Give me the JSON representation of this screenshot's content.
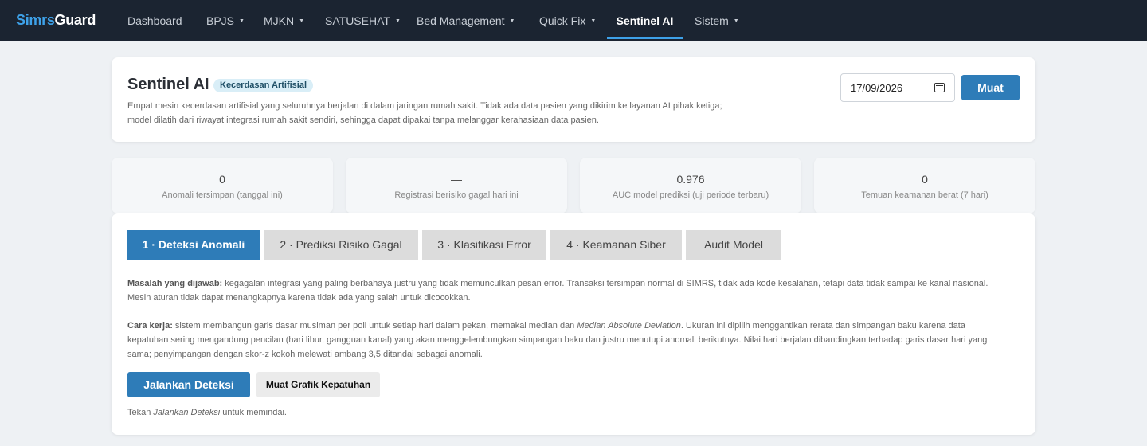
{
  "brand": {
    "part1": "Simrs",
    "part2": "Guard"
  },
  "nav": {
    "items": [
      {
        "label": "Dashboard",
        "caret": ""
      },
      {
        "label": "BPJS",
        "caret": "▼"
      },
      {
        "label": "MJKN",
        "caret": "▼"
      },
      {
        "label": "SATUSEHAT",
        "caret": "▼"
      },
      {
        "label": "Bed Management",
        "caret": "▼"
      },
      {
        "label": "Quick Fix",
        "caret": "▼"
      },
      {
        "label": "Sentinel AI",
        "caret": ""
      },
      {
        "label": "Sistem",
        "caret": "▼"
      }
    ],
    "active": "Sentinel AI"
  },
  "header": {
    "title": "Sentinel AI",
    "badge": "Kecerdasan Artifisial",
    "description": "Empat mesin kecerdasan artifisial yang seluruhnya berjalan di dalam jaringan rumah sakit. Tidak ada data pasien yang dikirim ke layanan AI pihak ketiga; model dilatih dari riwayat integrasi rumah sakit sendiri, sehingga dapat dipakai tanpa melanggar kerahasiaan data pasien.",
    "date_value": "17/09/2026",
    "load_label": "Muat"
  },
  "stats": [
    {
      "value": "0",
      "label": "Anomali tersimpan (tanggal ini)"
    },
    {
      "value": "—",
      "label": "Registrasi berisiko gagal hari ini"
    },
    {
      "value": "0.976",
      "label": "AUC model prediksi (uji periode terbaru)"
    },
    {
      "value": "0",
      "label": "Temuan keamanan berat (7 hari)"
    }
  ],
  "tabs": [
    {
      "label": "1 · Deteksi Anomali"
    },
    {
      "label": "2 · Prediksi Risiko Gagal"
    },
    {
      "label": "3 · Klasifikasi Error"
    },
    {
      "label": "4 · Keamanan Siber"
    },
    {
      "label": "Audit Model"
    }
  ],
  "active_tab": 0,
  "content": {
    "problem_label": "Masalah yang dijawab:",
    "problem_text": " kegagalan integrasi yang paling berbahaya justru yang tidak memunculkan pesan error. Transaksi tersimpan normal di SIMRS, tidak ada kode kesalahan, tetapi data tidak sampai ke kanal nasional. Mesin aturan tidak dapat menangkapnya karena tidak ada yang salah untuk dicocokkan.",
    "method_label": "Cara kerja:",
    "method_text_1": " sistem membangun garis dasar musiman per poli untuk setiap hari dalam pekan, memakai median dan ",
    "method_emphasis": "Median Absolute Deviation",
    "method_text_2": ". Ukuran ini dipilih menggantikan rerata dan simpangan baku karena data kepatuhan sering mengandung pencilan (hari libur, gangguan kanal) yang akan menggelembungkan simpangan baku dan justru menutupi anomali berikutnya. Nilai hari berjalan dibandingkan terhadap garis dasar hari yang sama; penyimpangan dengan skor-z kokoh melewati ambang 3,5 ditandai sebagai anomali.",
    "run_label": "Jalankan Deteksi",
    "chart_label": "Muat Grafik Kepatuhan",
    "hint_prefix": "Tekan ",
    "hint_emphasis": "Jalankan Deteksi",
    "hint_suffix": " untuk memindai."
  }
}
